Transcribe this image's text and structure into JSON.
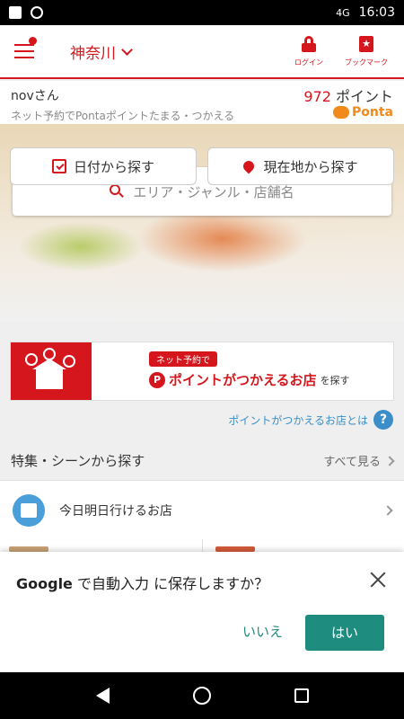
{
  "status": {
    "time": "16:03",
    "network": "4G"
  },
  "header": {
    "region": "神奈川",
    "login_label": "ログイン",
    "bookmark_label": "ブックマーク"
  },
  "user": {
    "name": "novさん",
    "subtitle": "ネット予約でPontaポイントたまる・つかえる",
    "points_value": "972",
    "points_unit": "ポイント",
    "ponta_logo": "Ponta"
  },
  "search": {
    "placeholder": "エリア・ジャンル・店舗名"
  },
  "buttons": {
    "by_date": "日付から探す",
    "by_location": "現在地から探す"
  },
  "banner": {
    "tag": "ネット予約で",
    "main": "ポイントがつかえるお店",
    "suffix": "を探す"
  },
  "what_link": "ポイントがつかえるお店とは",
  "section": {
    "title": "特集・シーンから探す",
    "see_all": "すべて見る"
  },
  "list": [
    {
      "label": "今日明日行けるお店"
    }
  ],
  "autofill": {
    "brand": "Google",
    "text": " で自動入力 に保存しますか？",
    "no": "いいえ",
    "yes": "はい"
  },
  "colors": {
    "brand_red": "#d5161d",
    "teal": "#1e8c7e",
    "link_blue": "#3b8ec7"
  }
}
